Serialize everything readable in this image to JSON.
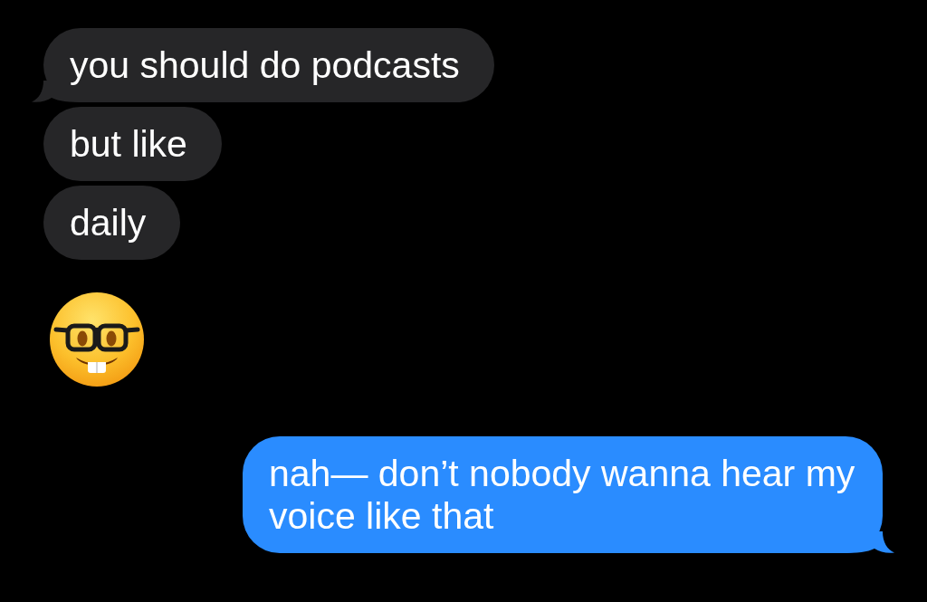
{
  "messages": [
    {
      "kind": "text",
      "outgoing": false,
      "text": "you should do podcasts",
      "tail": true
    },
    {
      "kind": "text",
      "outgoing": false,
      "text": "but like",
      "tail": false
    },
    {
      "kind": "text",
      "outgoing": false,
      "text": "daily",
      "tail": false
    },
    {
      "kind": "emoji"
    },
    {
      "kind": "text",
      "outgoing": true,
      "text": "nah— don’t nobody wanna hear my voice like that",
      "tail": true
    }
  ]
}
